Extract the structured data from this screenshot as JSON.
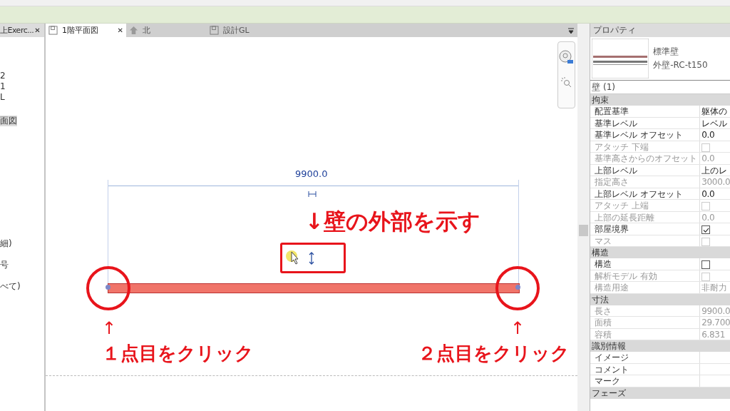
{
  "tabs": [
    {
      "label": "上Exerc...",
      "selected": false,
      "kind": "project",
      "close": "✕"
    },
    {
      "label": "1階平面図",
      "selected": true,
      "kind": "view",
      "close": "✕"
    },
    {
      "label": "北",
      "selected": false,
      "kind": "elevation"
    },
    {
      "label": "設計GL",
      "selected": false,
      "kind": "view"
    }
  ],
  "browser": {
    "items": [
      {
        "label": "2",
        "selected": false
      },
      {
        "label": "1",
        "selected": false
      },
      {
        "label": "L",
        "selected": false
      },
      {
        "label": "面図",
        "selected": true
      },
      {
        "label": "細)",
        "selected": false
      },
      {
        "label": "号",
        "selected": false
      },
      {
        "label": "べて)",
        "selected": false
      }
    ]
  },
  "canvas": {
    "dimension": "9900.0",
    "note": "↓壁の外部を示す",
    "start_arrow": "↑",
    "start_label": "１点目をクリック",
    "end_arrow": "↑",
    "end_label": "２点目をクリック"
  },
  "properties": {
    "title": "プロパティ",
    "type_family": "標準壁",
    "type_name": "外壁-RC-t150",
    "selection": "壁 (1)",
    "groups": [
      {
        "label": "拘束",
        "rows": [
          {
            "label": "配置基準",
            "kind": "text",
            "value": "躯体の",
            "disabled": false
          },
          {
            "label": "基準レベル",
            "kind": "text",
            "value": "レベル",
            "disabled": false
          },
          {
            "label": "基準レベル オフセット",
            "kind": "text",
            "value": "0.0",
            "disabled": false
          },
          {
            "label": "アタッチ 下端",
            "kind": "checkbox",
            "checked": false,
            "disabled": true
          },
          {
            "label": "基準高さからのオフセット",
            "kind": "text",
            "value": "0.0",
            "disabled": true
          },
          {
            "label": "上部レベル",
            "kind": "text",
            "value": "上のレ",
            "disabled": false
          },
          {
            "label": "指定高さ",
            "kind": "text",
            "value": "3000.0",
            "disabled": true
          },
          {
            "label": "上部レベル オフセット",
            "kind": "text",
            "value": "0.0",
            "disabled": false
          },
          {
            "label": "アタッチ 上端",
            "kind": "checkbox",
            "checked": false,
            "disabled": true
          },
          {
            "label": "上部の延長距離",
            "kind": "text",
            "value": "0.0",
            "disabled": true
          },
          {
            "label": "部屋境界",
            "kind": "checkbox",
            "checked": true,
            "disabled": false
          },
          {
            "label": "マス",
            "kind": "checkbox",
            "checked": false,
            "disabled": true
          }
        ]
      },
      {
        "label": "構造",
        "rows": [
          {
            "label": "構造",
            "kind": "checkbox",
            "checked": false,
            "disabled": false
          },
          {
            "label": "解析モデル 有効",
            "kind": "checkbox",
            "checked": false,
            "disabled": true
          },
          {
            "label": "構造用途",
            "kind": "text",
            "value": "非耐力",
            "disabled": true
          }
        ]
      },
      {
        "label": "寸法",
        "rows": [
          {
            "label": "長さ",
            "kind": "text",
            "value": "9900.0",
            "disabled": true
          },
          {
            "label": "面積",
            "kind": "text",
            "value": "29.700",
            "disabled": true
          },
          {
            "label": "容積",
            "kind": "text",
            "value": "6.831",
            "disabled": true
          }
        ]
      },
      {
        "label": "識別情報",
        "rows": [
          {
            "label": "イメージ",
            "kind": "text",
            "disabled": false
          },
          {
            "label": "コメント",
            "kind": "text",
            "disabled": false
          },
          {
            "label": "マーク",
            "kind": "text",
            "disabled": false
          }
        ]
      },
      {
        "label": "フェーズ"
      }
    ]
  }
}
